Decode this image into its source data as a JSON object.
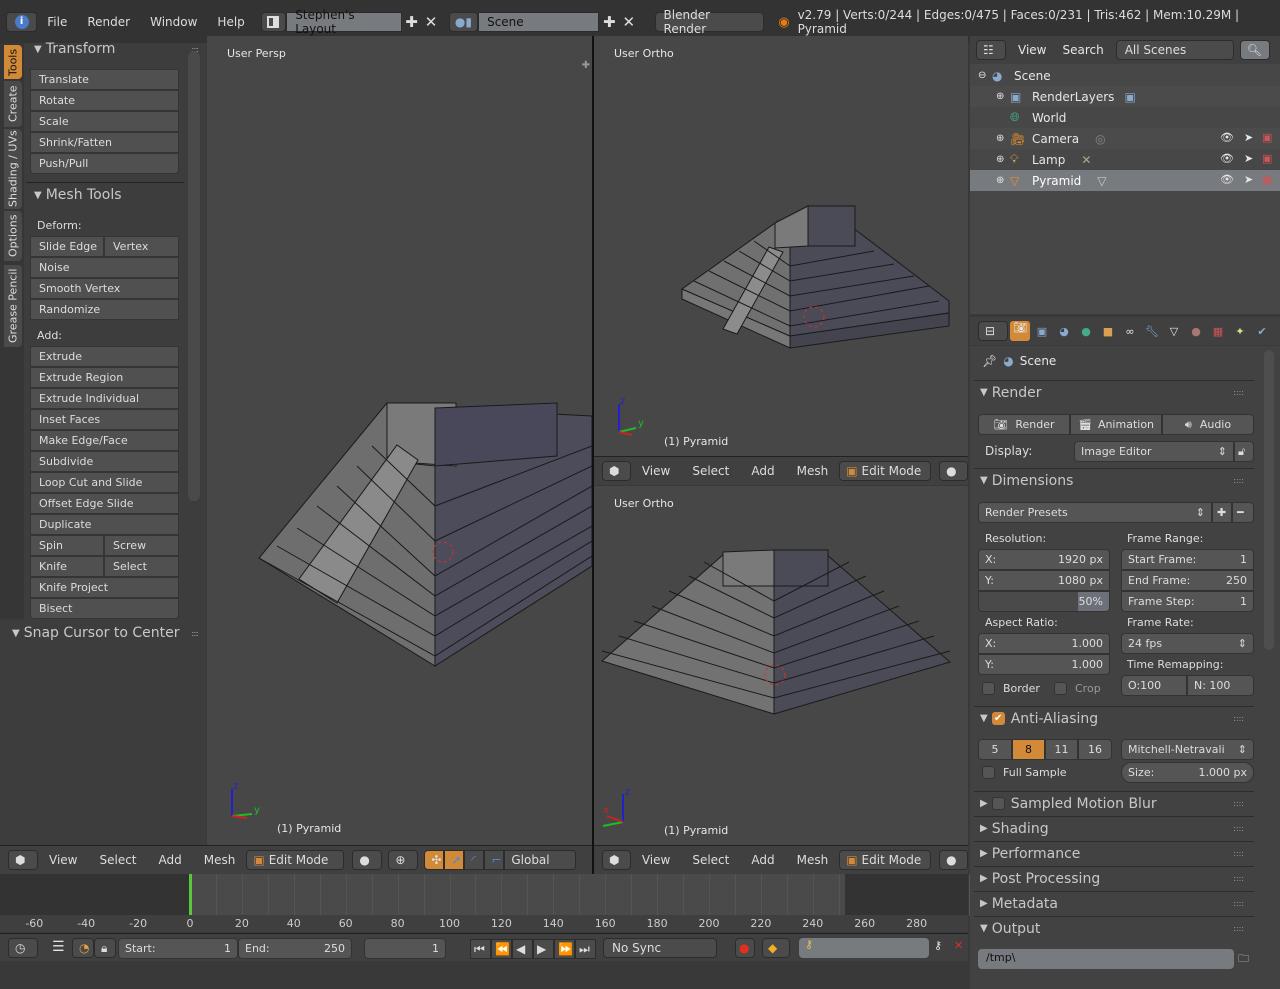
{
  "topbar": {
    "menus": [
      "File",
      "Render",
      "Window",
      "Help"
    ],
    "layout": "Stephen's Layout",
    "scene": "Scene",
    "engine": "Blender Render",
    "status": "v2.79 | Verts:0/244 | Edges:0/475 | Faces:0/231 | Tris:462 | Mem:10.29M | Pyramid",
    "icons": {
      "info": "info-icon",
      "layout": "screen-layout-icon",
      "scene": "scene-icon",
      "add": "plus-icon",
      "remove": "x-icon",
      "blender": "blender-logo-icon"
    }
  },
  "tool_tabs": [
    "Tools",
    "Create",
    "Shading / UVs",
    "Options",
    "Grease Pencil"
  ],
  "tool_shelf": {
    "transform": {
      "title": "Transform",
      "buttons": [
        "Translate",
        "Rotate",
        "Scale",
        "Shrink/Fatten",
        "Push/Pull"
      ]
    },
    "mesh_tools": {
      "title": "Mesh Tools",
      "deform_label": "Deform:",
      "deform": [
        "Slide Edge",
        "Vertex",
        "Noise",
        "Smooth Vertex",
        "Randomize"
      ],
      "add_label": "Add:",
      "add": [
        "Extrude",
        "Extrude Region",
        "Extrude Individual",
        "Inset Faces",
        "Make Edge/Face",
        "Subdivide",
        "Loop Cut and Slide",
        "Offset Edge Slide",
        "Duplicate",
        "Spin",
        "Screw",
        "Knife",
        "Select",
        "Knife Project",
        "Bisect"
      ]
    },
    "snap": {
      "title": "Snap Cursor to Center"
    }
  },
  "viewports": {
    "persp": {
      "label": "User Persp",
      "object": "(1) Pyramid"
    },
    "ortho_top": {
      "label": "User Ortho",
      "object": "(1) Pyramid"
    },
    "ortho_bottom": {
      "label": "User Ortho",
      "object": "(1) Pyramid"
    }
  },
  "viewport_header": {
    "menus": [
      "View",
      "Select",
      "Add",
      "Mesh"
    ],
    "mode": "Edit Mode",
    "orientation": "Global"
  },
  "timeline": {
    "ticks": [
      "-60",
      "-40",
      "-20",
      "0",
      "20",
      "40",
      "60",
      "80",
      "100",
      "120",
      "140",
      "160",
      "180",
      "200",
      "220",
      "240",
      "260",
      "280"
    ],
    "current_frame_marker": 0,
    "start_label": "Start:",
    "start": "1",
    "end_label": "End:",
    "end": "250",
    "current": "1",
    "sync": "No Sync",
    "playback_icons": [
      "jump-start-icon",
      "prev-keyframe-icon",
      "play-reverse-icon",
      "play-icon",
      "next-keyframe-icon",
      "jump-end-icon"
    ]
  },
  "outliner": {
    "menus": [
      "View",
      "Search"
    ],
    "filter": "All Scenes",
    "items": [
      {
        "name": "Scene",
        "depth": 0,
        "selected": false
      },
      {
        "name": "RenderLayers",
        "depth": 1,
        "selected": false
      },
      {
        "name": "World",
        "depth": 1,
        "selected": false
      },
      {
        "name": "Camera",
        "depth": 1,
        "selected": false
      },
      {
        "name": "Lamp",
        "depth": 1,
        "selected": false
      },
      {
        "name": "Pyramid",
        "depth": 1,
        "selected": true
      }
    ]
  },
  "properties": {
    "context": "Scene",
    "render": {
      "title": "Render",
      "buttons": [
        "Render",
        "Animation",
        "Audio"
      ],
      "display_label": "Display:",
      "display": "Image Editor"
    },
    "dimensions": {
      "title": "Dimensions",
      "presets": "Render Presets",
      "resolution_label": "Resolution:",
      "res_x_label": "X:",
      "res_x": "1920 px",
      "res_y_label": "Y:",
      "res_y": "1080 px",
      "res_percent": "50%",
      "res_percent_value": 0.5,
      "aspect_label": "Aspect Ratio:",
      "asp_x_label": "X:",
      "asp_x": "1.000",
      "asp_y_label": "Y:",
      "asp_y": "1.000",
      "border": "Border",
      "crop": "Crop",
      "frame_range_label": "Frame Range:",
      "start_label": "Start Frame:",
      "start": "1",
      "end_label": "End Frame:",
      "end": "250",
      "step_label": "Frame Step:",
      "step": "1",
      "frame_rate_label": "Frame Rate:",
      "frame_rate": "24 fps",
      "time_remap_label": "Time Remapping:",
      "old": "O:100",
      "new": "N: 100"
    },
    "anti_aliasing": {
      "title": "Anti-Aliasing",
      "enabled": true,
      "samples": [
        "5",
        "8",
        "11",
        "16"
      ],
      "selected": "8",
      "filter": "Mitchell-Netravali",
      "full_sample": "Full Sample",
      "size_label": "Size:",
      "size": "1.000 px"
    },
    "collapsed": [
      "Sampled Motion Blur",
      "Shading",
      "Performance",
      "Post Processing",
      "Metadata"
    ],
    "output": {
      "title": "Output",
      "path": "/tmp\\"
    }
  },
  "colors": {
    "accent": "#d28a38",
    "selected_row": "#777a7e",
    "frame_marker": "#5ac83a"
  }
}
